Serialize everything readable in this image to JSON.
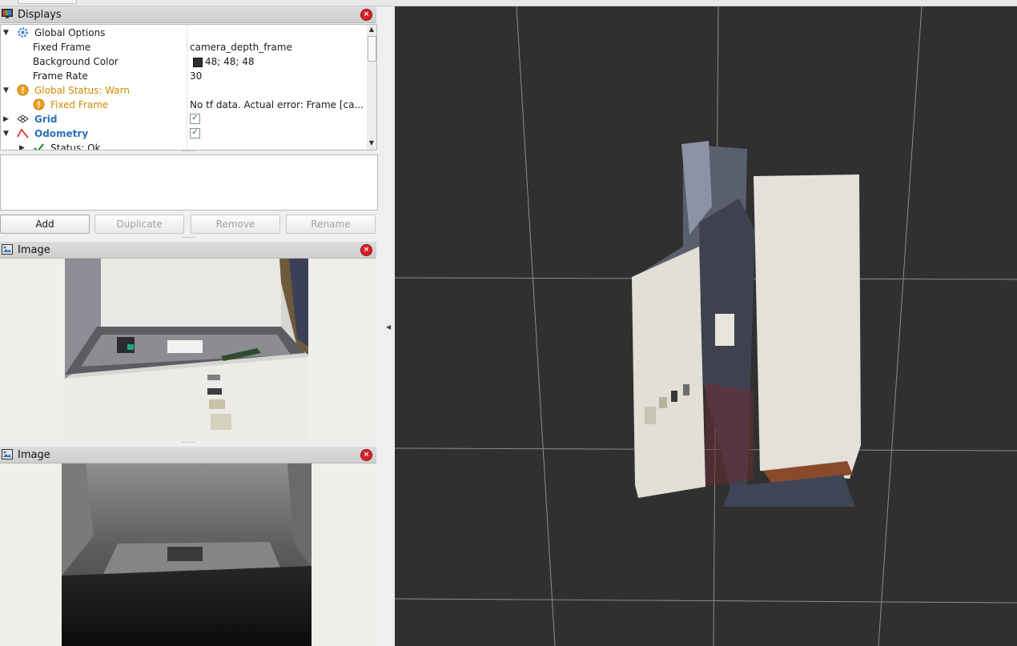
{
  "displays_panel": {
    "title": "Displays",
    "rows": [
      {
        "name": "Global Options",
        "value": ""
      },
      {
        "name": "Fixed Frame",
        "value": "camera_depth_frame"
      },
      {
        "name": "Background Color",
        "value": "48; 48; 48"
      },
      {
        "name": "Frame Rate",
        "value": "30"
      },
      {
        "name": "Global Status: Warn",
        "value": ""
      },
      {
        "name": "Fixed Frame",
        "value": "No tf data.  Actual error: Frame [ca..."
      },
      {
        "name": "Grid",
        "value": ""
      },
      {
        "name": "Odometry",
        "value": ""
      },
      {
        "name": "Status: Ok",
        "value": ""
      }
    ],
    "background_color_swatch": "#303030",
    "warn_color": "#d08a00",
    "link_color": "#2a6fb8"
  },
  "buttons": {
    "add": "Add",
    "duplicate": "Duplicate",
    "remove": "Remove",
    "rename": "Rename"
  },
  "image_panels": [
    {
      "title": "Image"
    },
    {
      "title": "Image"
    }
  ],
  "view3d": {
    "background": "#303030"
  }
}
